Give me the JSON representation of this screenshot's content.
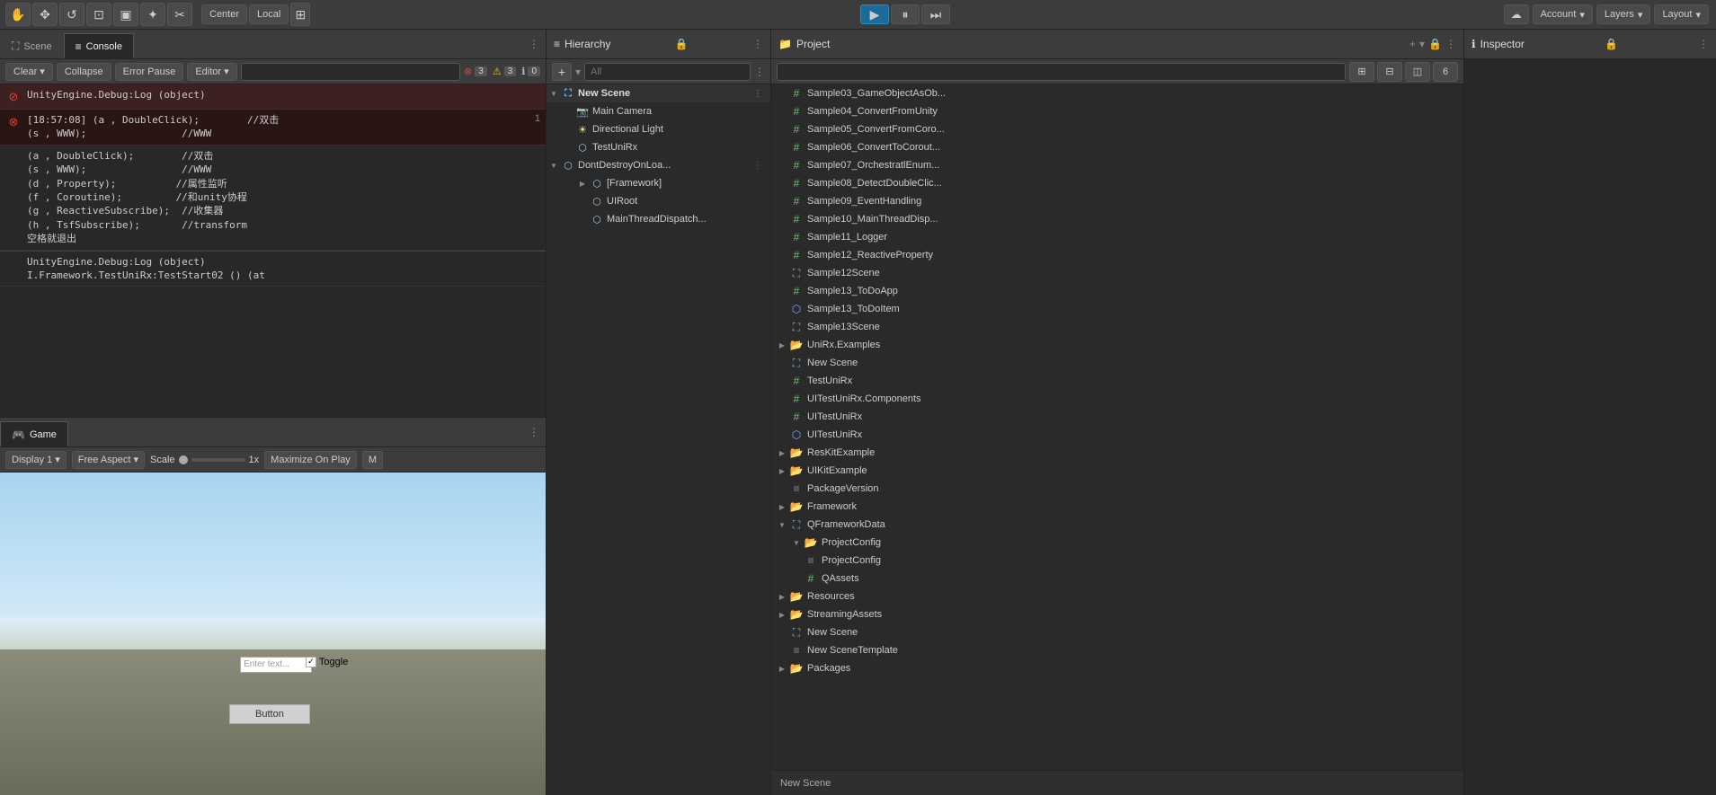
{
  "toolbar": {
    "play_label": "▶",
    "pause_label": "⏸",
    "step_label": "⏭",
    "account_label": "Account",
    "layers_label": "Layers",
    "layout_label": "Layout",
    "cloud_icon": "☁",
    "tools": [
      "✋",
      "✥",
      "↺",
      "⊡",
      "▣",
      "✳",
      "✂"
    ],
    "center_label": "Center",
    "local_label": "Local",
    "grid_label": "⊞"
  },
  "console": {
    "tab_scene_label": "Scene",
    "tab_console_label": "Console",
    "btn_clear": "Clear",
    "btn_collapse": "Collapse",
    "btn_error_pause": "Error Pause",
    "btn_editor": "Editor",
    "search_placeholder": "",
    "count_error": "3",
    "count_warn": "3",
    "count_info": "0",
    "entries": [
      {
        "type": "error",
        "text": "UnityEngine.Debug:Log (object)",
        "count": ""
      },
      {
        "type": "error",
        "text": "[18:57:08] (a , DoubleClick);        //双击\n(s , WWW);                //WWW",
        "count": "1"
      },
      {
        "type": "info",
        "text": "(a , DoubleClick);        //双击\n(s , WWW);                //WWW\n(d , Property);          //属性监听\n(f , Coroutine);         //和unity协程\n(g , ReactiveSubscribe);  //收集器\n(h , TsfSubscribe);       //transform\n空格就退出",
        "count": ""
      },
      {
        "type": "info",
        "text": "UnityEngine.Debug:Log (object)\nI.Framework.TestUniRx:TestStart02 () (at",
        "count": ""
      }
    ]
  },
  "game": {
    "tab_label": "Game",
    "display_label": "Display 1",
    "aspect_label": "Free Aspect",
    "scale_label": "Scale",
    "scale_value": "1x",
    "maximize_label": "Maximize On Play",
    "mute_label": "M",
    "ui_input_placeholder": "Enter text...",
    "ui_toggle_label": "Toggle",
    "ui_button_label": "Button"
  },
  "hierarchy": {
    "panel_label": "Hierarchy",
    "search_placeholder": "All",
    "scene_name": "New Scene",
    "items": [
      {
        "label": "New Scene",
        "type": "scene",
        "indent": 0,
        "expanded": true
      },
      {
        "label": "Main Camera",
        "type": "camera",
        "indent": 1,
        "expanded": false
      },
      {
        "label": "Directional Light",
        "type": "light",
        "indent": 1,
        "expanded": false
      },
      {
        "label": "TestUniRx",
        "type": "gameobj",
        "indent": 1,
        "expanded": false
      },
      {
        "label": "DontDestroyOnLoad",
        "type": "gameobj",
        "indent": 0,
        "expanded": true
      },
      {
        "label": "[Framework]",
        "type": "gameobj",
        "indent": 1,
        "expanded": false
      },
      {
        "label": "UIRoot",
        "type": "gameobj",
        "indent": 1,
        "expanded": false
      },
      {
        "label": "MainThreadDispatch",
        "type": "gameobj",
        "indent": 1,
        "expanded": false
      }
    ]
  },
  "project": {
    "panel_label": "Project",
    "search_placeholder": "",
    "items": [
      {
        "label": "Sample03_GameObjectAsOb...",
        "type": "script",
        "indent": 1
      },
      {
        "label": "Sample04_ConvertFromUnity",
        "type": "script",
        "indent": 1
      },
      {
        "label": "Sample05_ConvertFromCoro...",
        "type": "script",
        "indent": 1
      },
      {
        "label": "Sample06_ConvertToCorout...",
        "type": "script",
        "indent": 1
      },
      {
        "label": "Sample07_OrchestratlEnum...",
        "type": "script",
        "indent": 1
      },
      {
        "label": "Sample08_DetectDoubleClick",
        "type": "script",
        "indent": 1
      },
      {
        "label": "Sample09_EventHandling",
        "type": "script",
        "indent": 1
      },
      {
        "label": "Sample10_MainThreadDisp...",
        "type": "script",
        "indent": 1
      },
      {
        "label": "Sample11_Logger",
        "type": "script",
        "indent": 1
      },
      {
        "label": "Sample12_ReactiveProperty",
        "type": "script",
        "indent": 1
      },
      {
        "label": "Sample12Scene",
        "type": "scene-file",
        "indent": 1
      },
      {
        "label": "Sample13_ToDoApp",
        "type": "script",
        "indent": 1
      },
      {
        "label": "Sample13_ToDoItem",
        "type": "prefab",
        "indent": 1
      },
      {
        "label": "Sample13Scene",
        "type": "scene-file",
        "indent": 1
      },
      {
        "label": "UniRx.Examples",
        "type": "folder",
        "indent": 0,
        "expanded": false
      },
      {
        "label": "New Scene",
        "type": "scene-file",
        "indent": 1
      },
      {
        "label": "TestUniRx",
        "type": "script",
        "indent": 1
      },
      {
        "label": "UITestUniRx.Components",
        "type": "script",
        "indent": 1
      },
      {
        "label": "UITestUniRx",
        "type": "script",
        "indent": 1
      },
      {
        "label": "UITestUniRx",
        "type": "prefab",
        "indent": 1
      },
      {
        "label": "ResKitExample",
        "type": "folder",
        "indent": 0,
        "expanded": false
      },
      {
        "label": "UIKitExample",
        "type": "folder",
        "indent": 0,
        "expanded": false
      },
      {
        "label": "PackageVersion",
        "type": "asset",
        "indent": 1
      },
      {
        "label": "Framework",
        "type": "folder",
        "indent": 0,
        "expanded": false
      },
      {
        "label": "QFrameworkData",
        "type": "folder",
        "indent": 0,
        "expanded": true
      },
      {
        "label": "ProjectConfig",
        "type": "folder",
        "indent": 1,
        "expanded": true
      },
      {
        "label": "ProjectConfig",
        "type": "asset",
        "indent": 2
      },
      {
        "label": "QAssets",
        "type": "script",
        "indent": 2
      },
      {
        "label": "Resources",
        "type": "folder",
        "indent": 0,
        "expanded": false
      },
      {
        "label": "StreamingAssets",
        "type": "folder",
        "indent": 0,
        "expanded": false
      },
      {
        "label": "New Scene",
        "type": "scene-file",
        "indent": 1
      },
      {
        "label": "New SceneTemplate",
        "type": "asset",
        "indent": 1
      },
      {
        "label": "Packages",
        "type": "folder",
        "indent": 0,
        "expanded": false
      }
    ]
  },
  "inspector": {
    "panel_label": "Inspector"
  },
  "bottom_bar": {
    "new_scene_text": "New Scene"
  },
  "colors": {
    "accent_blue": "#1c4f7a",
    "toolbar_bg": "#3c3c3c",
    "panel_bg": "#282828",
    "border": "#232323"
  }
}
